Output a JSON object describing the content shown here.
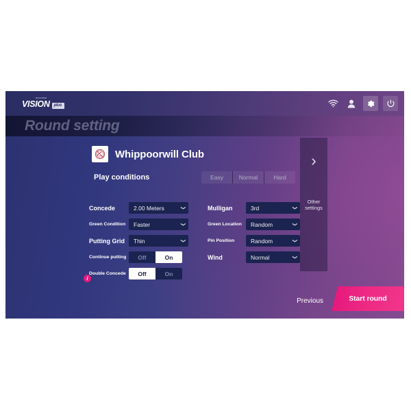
{
  "app": {
    "logo_sub": "GOLFZON",
    "logo_main": "VISION",
    "logo_badge": "plus"
  },
  "topbar": {
    "icons": [
      {
        "name": "wifi-icon",
        "label": "wifi"
      },
      {
        "name": "user-icon",
        "label": "user"
      },
      {
        "name": "gear-icon",
        "label": "settings"
      },
      {
        "name": "power-icon",
        "label": "power"
      }
    ]
  },
  "page": {
    "title": "Round setting",
    "course_name": "Whippoorwill Club",
    "section_heading": "Play conditions"
  },
  "difficulty": {
    "tabs": [
      {
        "label": "Easy",
        "selected": false
      },
      {
        "label": "Normal",
        "selected": false
      },
      {
        "label": "Hard",
        "selected": false
      }
    ]
  },
  "left_options": [
    {
      "label": "Concede",
      "type": "select",
      "value": "2.00 Meters",
      "label_size": "big"
    },
    {
      "label": "Green Condition",
      "type": "select",
      "value": "Faster",
      "label_size": "sm"
    },
    {
      "label": "Putting Grid",
      "type": "select",
      "value": "Thin",
      "label_size": "big"
    },
    {
      "label": "Continue putting",
      "type": "toggle",
      "off": "Off",
      "on": "On",
      "value": "On",
      "label_size": "sm"
    },
    {
      "label": "Double Concede",
      "type": "toggle",
      "off": "Off",
      "on": "On",
      "value": "Off",
      "label_size": "sm"
    }
  ],
  "right_options": [
    {
      "label": "Mulligan",
      "type": "select",
      "value": "3rd",
      "label_size": "big"
    },
    {
      "label": "Green Location",
      "type": "select",
      "value": "Random",
      "label_size": "sm"
    },
    {
      "label": "Pin Position",
      "type": "select",
      "value": "Random",
      "label_size": "sm"
    },
    {
      "label": "Wind",
      "type": "select",
      "value": "Normal",
      "label_size": "big"
    }
  ],
  "info_badge": "i",
  "other_panel": {
    "chevron": "›",
    "label_line1": "Other",
    "label_line2": "settings"
  },
  "footer": {
    "previous_label": "Previous",
    "start_label": "Start round"
  },
  "colors": {
    "accent_pink": "#e8197d",
    "select_bg": "#1b2350",
    "panel_bg": "#2c3170"
  }
}
